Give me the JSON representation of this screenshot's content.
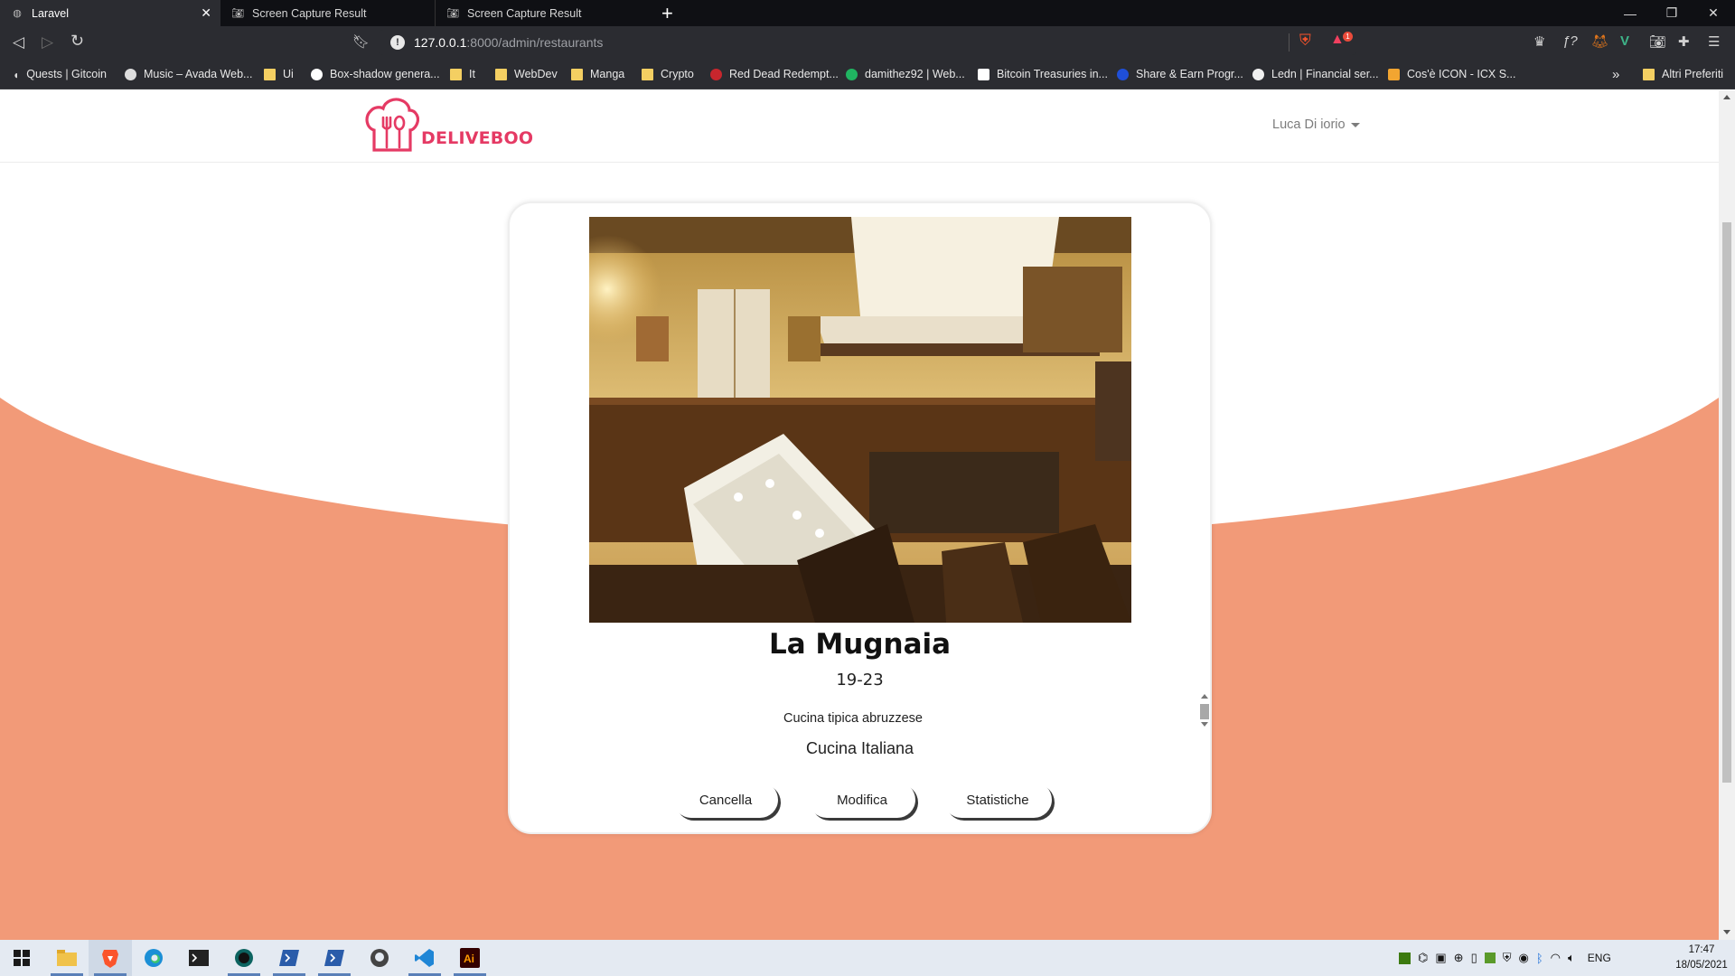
{
  "browser": {
    "tabs": [
      {
        "title": "Laravel",
        "active": true
      },
      {
        "title": "Screen Capture Result",
        "active": false
      },
      {
        "title": "Screen Capture Result",
        "active": false
      }
    ],
    "url_host": "127.0.0.1",
    "url_rest": ":8000/admin/restaurants",
    "bookmarks": [
      "Quests | Gitcoin",
      "Music – Avada Web...",
      "Ui",
      "Box-shadow genera...",
      "It",
      "WebDev",
      "Manga",
      "Crypto",
      "Red Dead Redempt...",
      "damithez92 | Web...",
      "Bitcoin Treasuries in...",
      "Share & Earn Progr...",
      "Ledn | Financial ser...",
      "Cos'è ICON - ICX S..."
    ],
    "bookmarks_more": "»",
    "other_bookmarks": "Altri Preferiti",
    "brave_badge": "1"
  },
  "site": {
    "logo_text": "DELIVEBOO",
    "user_name": "Luca Di iorio"
  },
  "restaurant": {
    "name": "La Mugnaia",
    "hours": "19-23",
    "description": "Cucina tipica abruzzese",
    "cuisine": "Cucina Italiana"
  },
  "actions": {
    "delete": "Cancella",
    "edit": "Modifica",
    "stats": "Statistiche"
  },
  "colors": {
    "accent": "#f29a78",
    "brand": "#e53a64"
  },
  "taskbar": {
    "language": "ENG",
    "time": "17:47",
    "date": "18/05/2021"
  }
}
